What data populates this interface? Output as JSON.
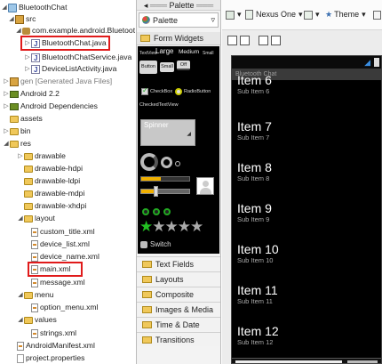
{
  "tree": {
    "project": "BluetoothChat",
    "src": "src",
    "package": "com.example.android.BluetoothCha",
    "files_java": [
      "BluetoothChat.java",
      "BluetoothChatService.java",
      "DeviceListActivity.java"
    ],
    "gen": "gen [Generated Java Files]",
    "android": "Android 2.2",
    "deps": "Android Dependencies",
    "assets": "assets",
    "bin": "bin",
    "res": "res",
    "drawable_folders": [
      "drawable",
      "drawable-hdpi",
      "drawable-ldpi",
      "drawable-mdpi",
      "drawable-xhdpi"
    ],
    "layout": "layout",
    "layout_files": [
      "custom_title.xml",
      "device_list.xml",
      "device_name.xml",
      "main.xml",
      "message.xml"
    ],
    "menu": "menu",
    "menu_files": [
      "option_menu.xml"
    ],
    "values": "values",
    "values_files": [
      "strings.xml"
    ],
    "manifest": "AndroidManifest.xml",
    "properties": "project.properties"
  },
  "palette": {
    "title": "Palette",
    "selected": "Palette",
    "form_widgets": "Form Widgets",
    "widget_texts": {
      "textview": "TextView",
      "large": "Large",
      "medium": "Medium",
      "small": "Small",
      "button": "Button",
      "small_btn": "Small",
      "off": "Off",
      "checkbox": "CheckBox",
      "radiobutton": "RadioButton",
      "checkedtextview": "CheckedTextView",
      "spinner": "Spinner",
      "switch": "Switch"
    },
    "categories": [
      "Text Fields",
      "Layouts",
      "Composite",
      "Images & Media",
      "Time & Date",
      "Transitions"
    ]
  },
  "editor": {
    "device": "Nexus One",
    "theme": "Theme",
    "app_title": "Bluetooth Chat",
    "items": [
      {
        "title": "Item 6",
        "sub": "Sub Item 6"
      },
      {
        "title": "Item 7",
        "sub": "Sub Item 7"
      },
      {
        "title": "Item 8",
        "sub": "Sub Item 8"
      },
      {
        "title": "Item 9",
        "sub": "Sub Item 9"
      },
      {
        "title": "Item 10",
        "sub": "Sub Item 10"
      },
      {
        "title": "Item 11",
        "sub": "Sub Item 11"
      },
      {
        "title": "Item 12",
        "sub": "Sub Item 12"
      }
    ]
  },
  "colors": {
    "highlight_outline": "#e01b1b",
    "phone_bg": "#000000",
    "accent_green": "#22c022"
  }
}
